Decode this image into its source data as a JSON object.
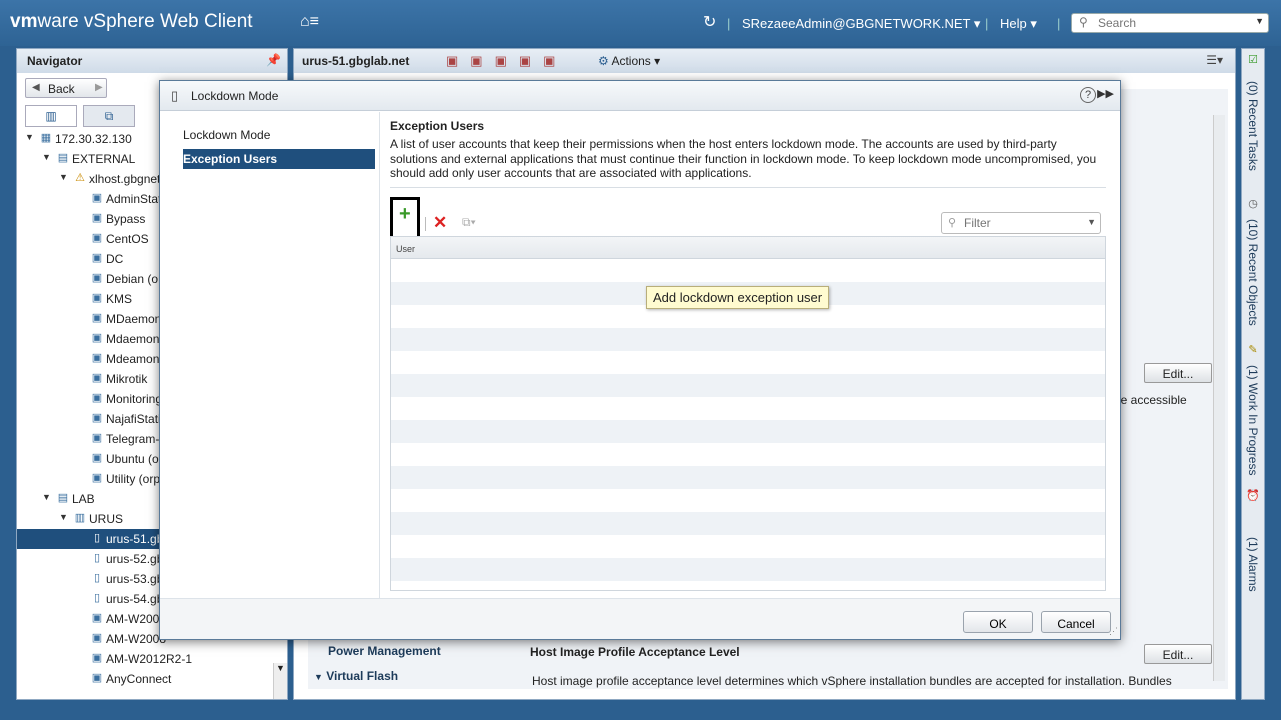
{
  "app": {
    "brand_prefix": "vm",
    "brand_rest": "ware",
    "brand_product": " vSphere Web Client",
    "user_menu": "SRezaeeAdmin@GBGNETWORK.NET ▾",
    "help_menu": "Help ▾",
    "search_placeholder": "Search"
  },
  "navigator": {
    "title": "Navigator",
    "back_label": "Back",
    "tree": [
      {
        "label": "172.30.32.130",
        "depth": 0,
        "icon": "datacenter-icon",
        "expanded": true
      },
      {
        "label": "EXTERNAL",
        "depth": 1,
        "icon": "folder-icon",
        "expanded": true
      },
      {
        "label": "xlhost.gbgnet",
        "depth": 2,
        "icon": "host-warning-icon",
        "expanded": true
      },
      {
        "label": "AdminStat",
        "depth": 3,
        "icon": "vm-icon"
      },
      {
        "label": "Bypass",
        "depth": 3,
        "icon": "vm-icon"
      },
      {
        "label": "CentOS",
        "depth": 3,
        "icon": "vm-icon"
      },
      {
        "label": "DC",
        "depth": 3,
        "icon": "vm-icon"
      },
      {
        "label": "Debian (o",
        "depth": 3,
        "icon": "vm-icon"
      },
      {
        "label": "KMS",
        "depth": 3,
        "icon": "vm-icon"
      },
      {
        "label": "MDaemon",
        "depth": 3,
        "icon": "vm-icon"
      },
      {
        "label": "Mdaemon",
        "depth": 3,
        "icon": "vm-icon"
      },
      {
        "label": "Mdeamon",
        "depth": 3,
        "icon": "vm-icon"
      },
      {
        "label": "Mikrotik",
        "depth": 3,
        "icon": "vm-icon"
      },
      {
        "label": "Monitoring",
        "depth": 3,
        "icon": "vm-icon"
      },
      {
        "label": "NajafiStati",
        "depth": 3,
        "icon": "vm-icon"
      },
      {
        "label": "Telegram-",
        "depth": 3,
        "icon": "vm-icon"
      },
      {
        "label": "Ubuntu (o",
        "depth": 3,
        "icon": "vm-icon"
      },
      {
        "label": "Utility (orp",
        "depth": 3,
        "icon": "vm-icon"
      },
      {
        "label": "LAB",
        "depth": 1,
        "icon": "folder-icon",
        "expanded": true
      },
      {
        "label": "URUS",
        "depth": 2,
        "icon": "cluster-icon",
        "expanded": true
      },
      {
        "label": "urus-51.gb",
        "depth": 3,
        "icon": "host-icon",
        "selected": true
      },
      {
        "label": "urus-52.gb",
        "depth": 3,
        "icon": "host-icon"
      },
      {
        "label": "urus-53.gb",
        "depth": 3,
        "icon": "host-icon"
      },
      {
        "label": "urus-54.gb",
        "depth": 3,
        "icon": "host-icon"
      },
      {
        "label": "AM-W2008",
        "depth": 3,
        "icon": "vm-icon"
      },
      {
        "label": "AM-W2008",
        "depth": 3,
        "icon": "vm-icon"
      },
      {
        "label": "AM-W2012R2-1",
        "depth": 3,
        "icon": "vm-icon"
      },
      {
        "label": "AnyConnect",
        "depth": 3,
        "icon": "vm-icon"
      }
    ]
  },
  "main": {
    "host_title": "urus-51.gbglab.net",
    "actions_label": "Actions ▾",
    "edit_label": "Edit...",
    "bg_text_accessible": "be accessible",
    "bg_power_management": "Power Management",
    "bg_virtual_flash": "Virtual Flash",
    "bg_profile_title": "Host Image Profile Acceptance Level",
    "bg_profile_desc": "Host image profile acceptance level determines which vSphere installation bundles are accepted for installation. Bundles"
  },
  "rail": {
    "recent_tasks": "(0) Recent Tasks",
    "recent_objects": "(10) Recent Objects",
    "work_in_progress": "(1) Work In Progress",
    "alarms": "(1) Alarms"
  },
  "dialog": {
    "title": "Lockdown Mode",
    "nav": [
      {
        "label": "Lockdown Mode",
        "active": false
      },
      {
        "label": "Exception Users",
        "active": true
      }
    ],
    "section_title": "Exception Users",
    "section_desc": "A list of user accounts that keep their permissions when the host enters lockdown mode. The accounts are used by third-party solutions and external applications that must continue their function in lockdown mode. To keep lockdown mode uncompromised, you should add only user accounts that are associated with applications.",
    "filter_placeholder": "Filter",
    "column_user": "User",
    "tooltip": "Add lockdown exception user",
    "ok_label": "OK",
    "cancel_label": "Cancel",
    "rows": 14
  },
  "colors": {
    "selection": "#1f4f7d",
    "header_blue": "#2e6394",
    "add_green": "#3a9a2a",
    "delete_red": "#d22222"
  }
}
